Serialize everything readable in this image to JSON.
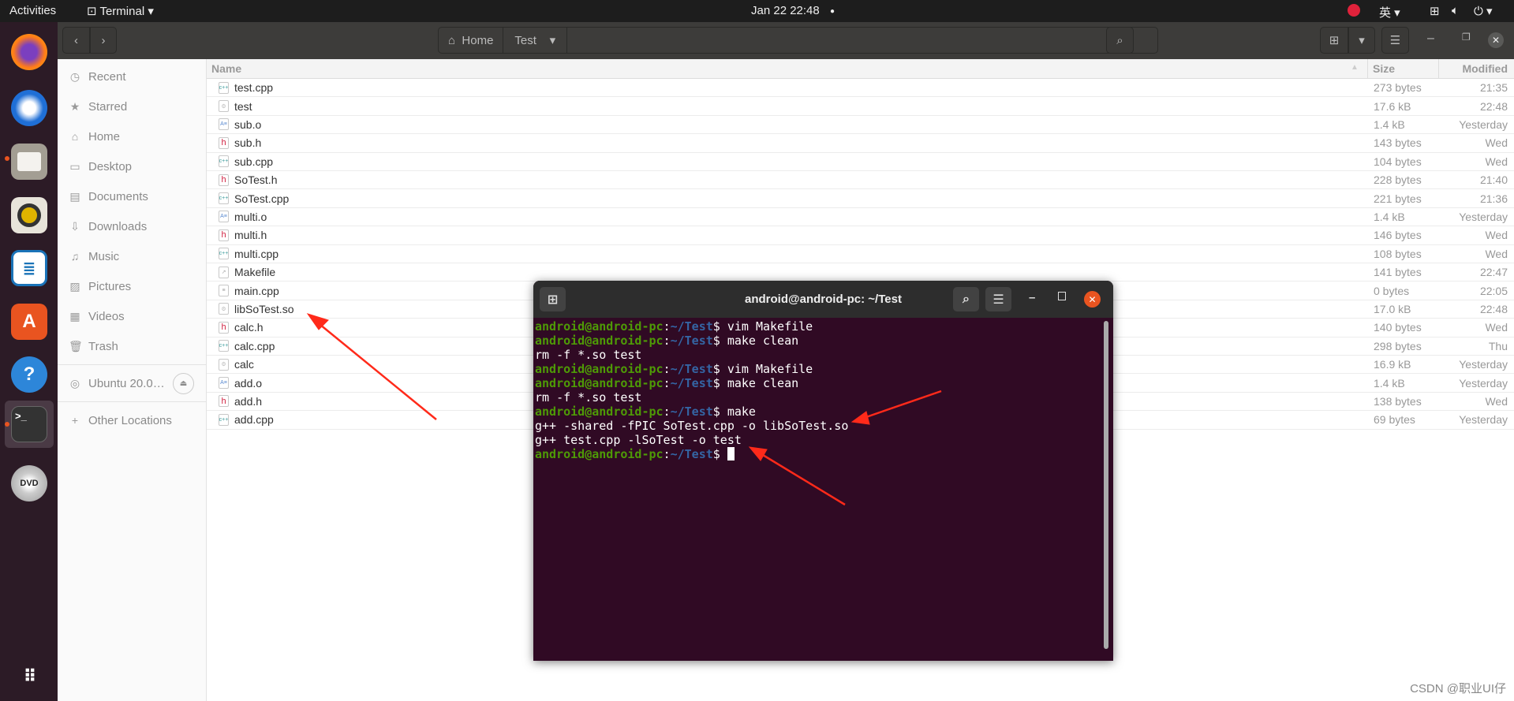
{
  "topbar": {
    "activities": "Activities",
    "app": "Terminal",
    "clock": "Jan 22  22:48",
    "ime": "英"
  },
  "toolbar": {
    "path": [
      {
        "label": "Home"
      },
      {
        "label": "Test"
      }
    ]
  },
  "sidebar": {
    "items": [
      {
        "label": "Recent",
        "icon": "clock-icon",
        "glyph": "◷"
      },
      {
        "label": "Starred",
        "icon": "star-icon",
        "glyph": "★"
      },
      {
        "label": "Home",
        "icon": "home-icon",
        "glyph": "⌂"
      },
      {
        "label": "Desktop",
        "icon": "desktop-icon",
        "glyph": "▭"
      },
      {
        "label": "Documents",
        "icon": "document-icon",
        "glyph": "▤"
      },
      {
        "label": "Downloads",
        "icon": "download-icon",
        "glyph": "⇩"
      },
      {
        "label": "Music",
        "icon": "music-icon",
        "glyph": "♫"
      },
      {
        "label": "Pictures",
        "icon": "picture-icon",
        "glyph": "▨"
      },
      {
        "label": "Videos",
        "icon": "video-icon",
        "glyph": "▦"
      },
      {
        "label": "Trash",
        "icon": "trash-icon",
        "glyph": "🗑"
      }
    ],
    "drive": "Ubuntu 20.0…",
    "other": "Other Locations"
  },
  "columns": {
    "name": "Name",
    "size": "Size",
    "modified": "Modified"
  },
  "files": [
    {
      "name": "test.cpp",
      "type": "cpp",
      "size": "273 bytes",
      "modified": "21:35"
    },
    {
      "name": "test",
      "type": "exec",
      "size": "17.6 kB",
      "modified": "22:48"
    },
    {
      "name": "sub.o",
      "type": "obj",
      "size": "1.4 kB",
      "modified": "Yesterday"
    },
    {
      "name": "sub.h",
      "type": "h",
      "size": "143 bytes",
      "modified": "Wed"
    },
    {
      "name": "sub.cpp",
      "type": "cpp",
      "size": "104 bytes",
      "modified": "Wed"
    },
    {
      "name": "SoTest.h",
      "type": "h",
      "size": "228 bytes",
      "modified": "21:40"
    },
    {
      "name": "SoTest.cpp",
      "type": "cpp",
      "size": "221 bytes",
      "modified": "21:36"
    },
    {
      "name": "multi.o",
      "type": "obj",
      "size": "1.4 kB",
      "modified": "Yesterday"
    },
    {
      "name": "multi.h",
      "type": "h",
      "size": "146 bytes",
      "modified": "Wed"
    },
    {
      "name": "multi.cpp",
      "type": "cpp",
      "size": "108 bytes",
      "modified": "Wed"
    },
    {
      "name": "Makefile",
      "type": "make",
      "size": "141 bytes",
      "modified": "22:47"
    },
    {
      "name": "main.cpp",
      "type": "text",
      "size": "0 bytes",
      "modified": "22:05"
    },
    {
      "name": "libSoTest.so",
      "type": "exec",
      "size": "17.0 kB",
      "modified": "22:48"
    },
    {
      "name": "calc.h",
      "type": "h",
      "size": "140 bytes",
      "modified": "Wed"
    },
    {
      "name": "calc.cpp",
      "type": "cpp",
      "size": "298 bytes",
      "modified": "Thu"
    },
    {
      "name": "calc",
      "type": "exec",
      "size": "16.9 kB",
      "modified": "Yesterday"
    },
    {
      "name": "add.o",
      "type": "obj",
      "size": "1.4 kB",
      "modified": "Yesterday"
    },
    {
      "name": "add.h",
      "type": "h",
      "size": "138 bytes",
      "modified": "Wed"
    },
    {
      "name": "add.cpp",
      "type": "cpp",
      "size": "69 bytes",
      "modified": "Yesterday"
    }
  ],
  "terminal": {
    "title": "android@android-pc: ~/Test",
    "prompt_user": "android@android-pc",
    "prompt_path": "~/Test",
    "lines": [
      {
        "prompt": true,
        "text": " vim Makefile"
      },
      {
        "prompt": true,
        "text": " make clean"
      },
      {
        "prompt": false,
        "text": "rm -f *.so test"
      },
      {
        "prompt": true,
        "text": " vim Makefile"
      },
      {
        "prompt": true,
        "text": " make clean"
      },
      {
        "prompt": false,
        "text": "rm -f *.so test"
      },
      {
        "prompt": true,
        "text": " make"
      },
      {
        "prompt": false,
        "text": "g++ -shared -fPIC SoTest.cpp -o libSoTest.so"
      },
      {
        "prompt": false,
        "text": "g++ test.cpp -lSoTest -o test"
      },
      {
        "prompt": true,
        "text": " ",
        "cursor": true
      }
    ]
  },
  "watermark": "CSDN @职业UI仔",
  "colors": {
    "accent": "#e95420",
    "terminal_bg": "#300a24",
    "prompt_user": "#4e9a06",
    "prompt_path": "#3465a4",
    "arrow": "#ff2a1a"
  }
}
